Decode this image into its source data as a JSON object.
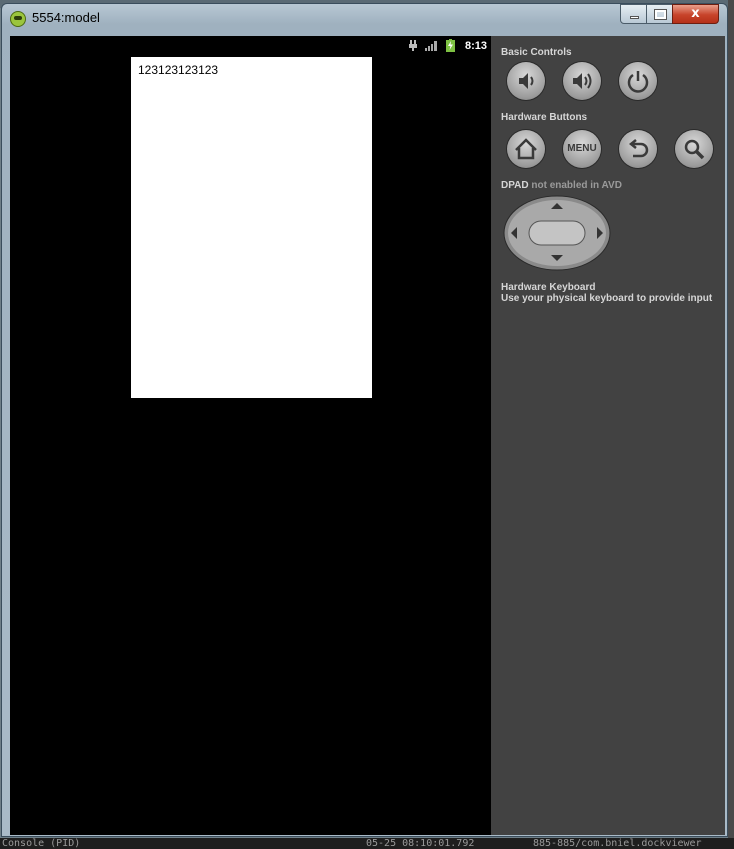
{
  "window": {
    "title": "5554:model",
    "close_glyph": "x"
  },
  "statusbar": {
    "time": "8:13",
    "icons": [
      "usb-icon",
      "signal-icon",
      "battery-charging-icon"
    ]
  },
  "webview": {
    "text": "123123123123"
  },
  "panel": {
    "basic_controls": "Basic Controls",
    "hardware_buttons": "Hardware Buttons",
    "dpad_label": "DPAD",
    "dpad_sub": "not enabled in AVD",
    "keyboard_title": "Hardware Keyboard",
    "keyboard_desc": "Use your physical keyboard to provide input",
    "menu_label": "MENU"
  },
  "background": {
    "bottom_left": "Console (PID)",
    "bottom_mid": "05-25 08:10:01.792",
    "bottom_right": "885-885/com.bniel.dockviewer"
  },
  "colors": {
    "panel_bg": "#424242",
    "screen_bg": "#000000",
    "webview_bg": "#ffffff"
  }
}
